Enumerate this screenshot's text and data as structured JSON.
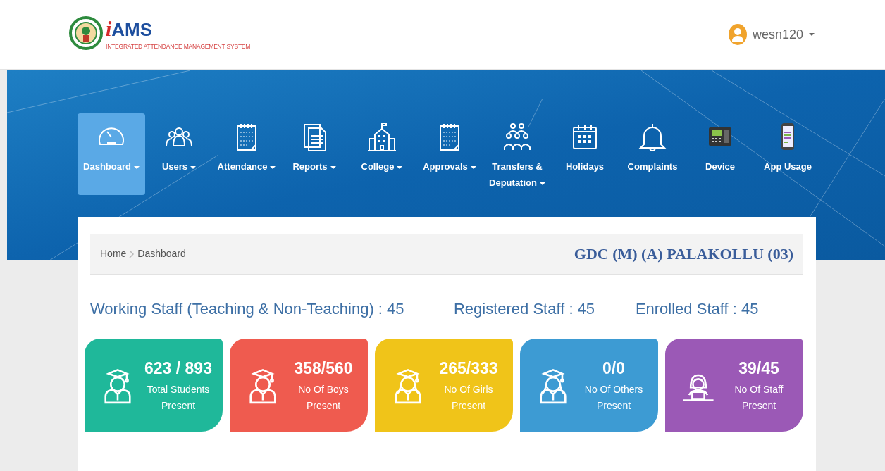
{
  "header": {
    "logo": "iAMS",
    "subtitle": "INTEGRATED ATTENDANCE MANAGEMENT SYSTEM",
    "user": "wesn120"
  },
  "nav": [
    {
      "label": "Dashboard",
      "dropdown": true,
      "selected": true
    },
    {
      "label": "Users",
      "dropdown": true,
      "selected": false
    },
    {
      "label": "Attendance",
      "dropdown": true,
      "selected": false
    },
    {
      "label": "Reports",
      "dropdown": true,
      "selected": false
    },
    {
      "label": "College",
      "dropdown": true,
      "selected": false
    },
    {
      "label": "Approvals",
      "dropdown": true,
      "selected": false
    },
    {
      "label": "Transfers & Deputation",
      "dropdown": true,
      "selected": false
    },
    {
      "label": "Holidays",
      "dropdown": false,
      "selected": false
    },
    {
      "label": "Complaints",
      "dropdown": false,
      "selected": false
    },
    {
      "label": "Device",
      "dropdown": false,
      "selected": false
    },
    {
      "label": "App Usage",
      "dropdown": false,
      "selected": false
    }
  ],
  "breadcrumb": [
    "Home",
    "Dashboard"
  ],
  "college": "GDC (M) (A) PALAKOLLU (03)",
  "staff_stats": [
    "Working Staff (Teaching & Non-Teaching) : 45",
    "Registered Staff : 45",
    "Enrolled Staff : 45"
  ],
  "cards": [
    {
      "value": "623 / 893",
      "label": "Total Students Present",
      "color": "#1fb89a"
    },
    {
      "value": "358/560",
      "label": "No Of Boys Present",
      "color": "#ef5b4f"
    },
    {
      "value": "265/333",
      "label": "No Of Girls Present",
      "color": "#f0c419"
    },
    {
      "value": "0/0",
      "label": "No Of Others Present",
      "color": "#3d9bd3"
    },
    {
      "value": "39/45",
      "label": "No Of Staff Present",
      "color": "#9b59b6"
    }
  ]
}
